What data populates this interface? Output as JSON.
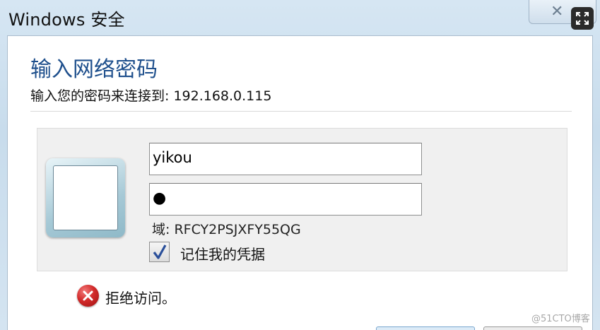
{
  "window": {
    "title": "Windows 安全"
  },
  "dialog": {
    "heading": "输入网络密码",
    "subtitle": "输入您的密码来连接到: 192.168.0.115"
  },
  "credentials": {
    "username_value": "yikou",
    "password_mask": "●",
    "domain_label": "域: RFCY2PSJXFY55QG",
    "remember_label": "记住我的凭据",
    "remember_checked": true
  },
  "status": {
    "error_text": "拒绝访问。",
    "error_icon": "error-icon"
  },
  "watermark": "@51CTO博客",
  "icons": {
    "close": "close-icon",
    "expand": "expand-icon",
    "user_tile": "user-tile-icon",
    "checkmark": "checkmark-icon"
  },
  "colors": {
    "heading": "#1e4f8c",
    "error": "#d22a2a",
    "frame": "#c8dcec"
  }
}
